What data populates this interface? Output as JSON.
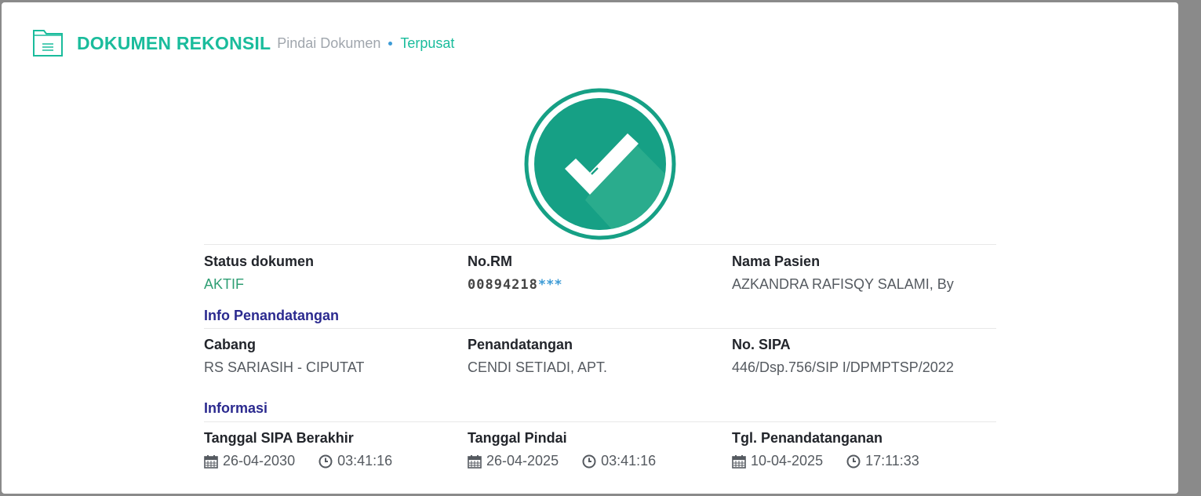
{
  "header": {
    "title": "DOKUMEN REKONSIL",
    "subtitle": "Pindai Dokumen",
    "crumb": "Terpusat"
  },
  "colors": {
    "accent": "#1abc9c",
    "check": "#16a085",
    "section": "#2b2a8f"
  },
  "status": {
    "status_label": "Status dokumen",
    "status_value": "AKTIF",
    "rm_label": "No.RM",
    "rm_value": "00894218",
    "rm_mask": "***",
    "patient_label": "Nama Pasien",
    "patient_value": "AZKANDRA RAFISQY SALAMI, By"
  },
  "signer": {
    "section": "Info Penandatangan",
    "branch_label": "Cabang",
    "branch_value": "RS SARIASIH - CIPUTAT",
    "signer_label": "Penandatangan",
    "signer_value": "CENDI SETIADI, APT.",
    "sipa_label": "No. SIPA",
    "sipa_value": "446/Dsp.756/SIP I/DPMPTSP/2022"
  },
  "info": {
    "section": "Informasi",
    "expire_label": "Tanggal SIPA Berakhir",
    "expire_date": "26-04-2030",
    "expire_time": "03:41:16",
    "scan_label": "Tanggal Pindai",
    "scan_date": "26-04-2025",
    "scan_time": "03:41:16",
    "sign_label": "Tgl. Penandatanganan",
    "sign_date": "10-04-2025",
    "sign_time": "17:11:33"
  },
  "icons": {
    "doc": "document-icon",
    "check": "checkmark-icon",
    "calendar": "calendar-icon",
    "clock": "clock-icon"
  }
}
